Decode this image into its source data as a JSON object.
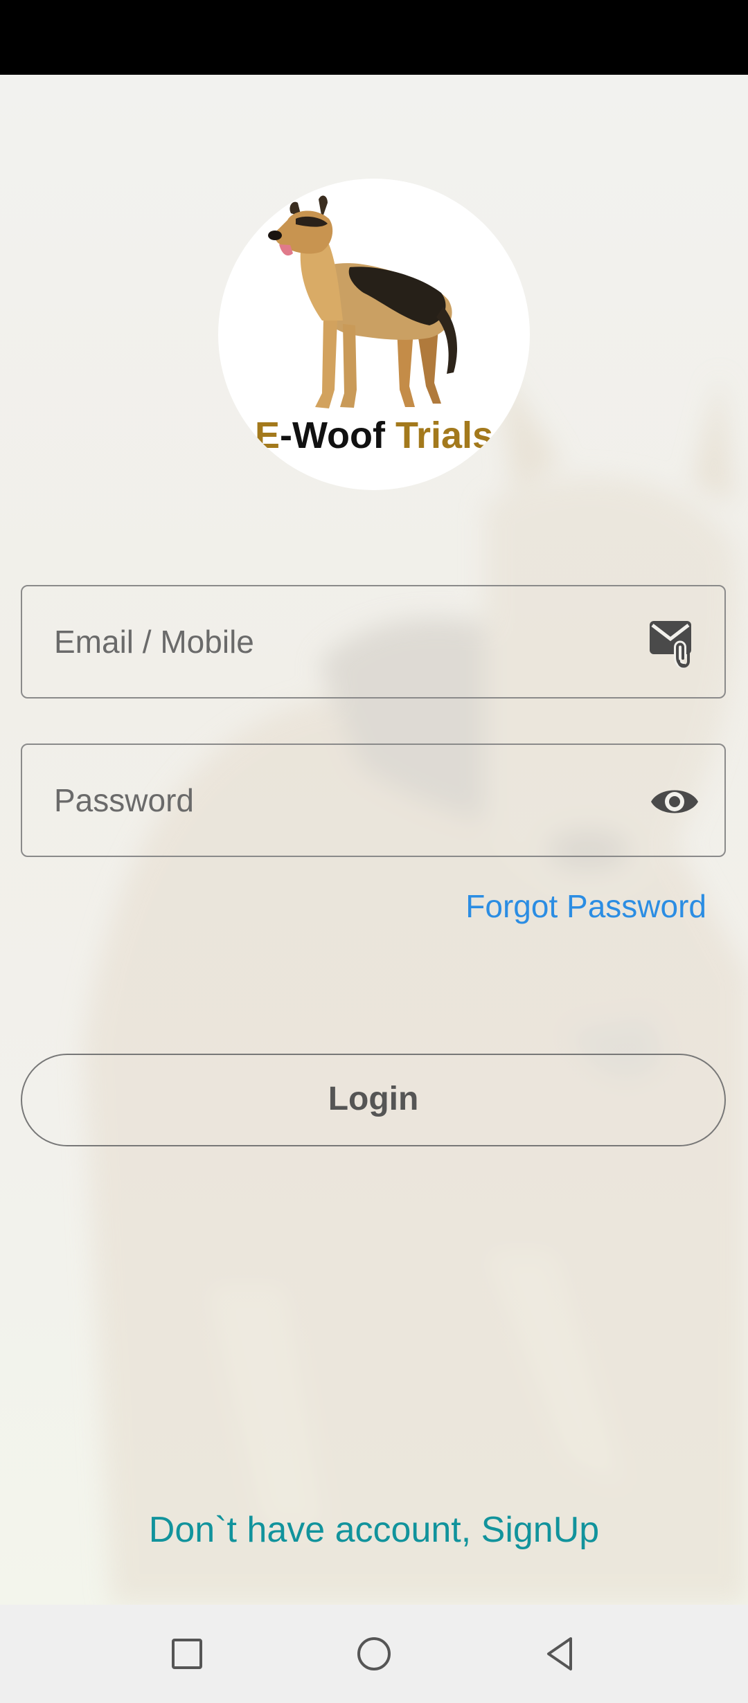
{
  "logo": {
    "prefix": "E",
    "middle": "-Woof ",
    "suffix": "Trials",
    "icon": "german-shepherd-dog"
  },
  "form": {
    "email_placeholder": "Email / Mobile",
    "email_icon": "mail-attachment-icon",
    "password_placeholder": "Password",
    "password_icon": "eye-icon",
    "forgot_label": "Forgot Password",
    "login_label": "Login"
  },
  "signup": {
    "label": "Don`t have account, SignUp"
  },
  "nav": {
    "recents_icon": "square-icon",
    "home_icon": "circle-icon",
    "back_icon": "triangle-back-icon"
  },
  "colors": {
    "link": "#2b8de3",
    "signup": "#11939c",
    "logo_accent": "#a3791c"
  }
}
